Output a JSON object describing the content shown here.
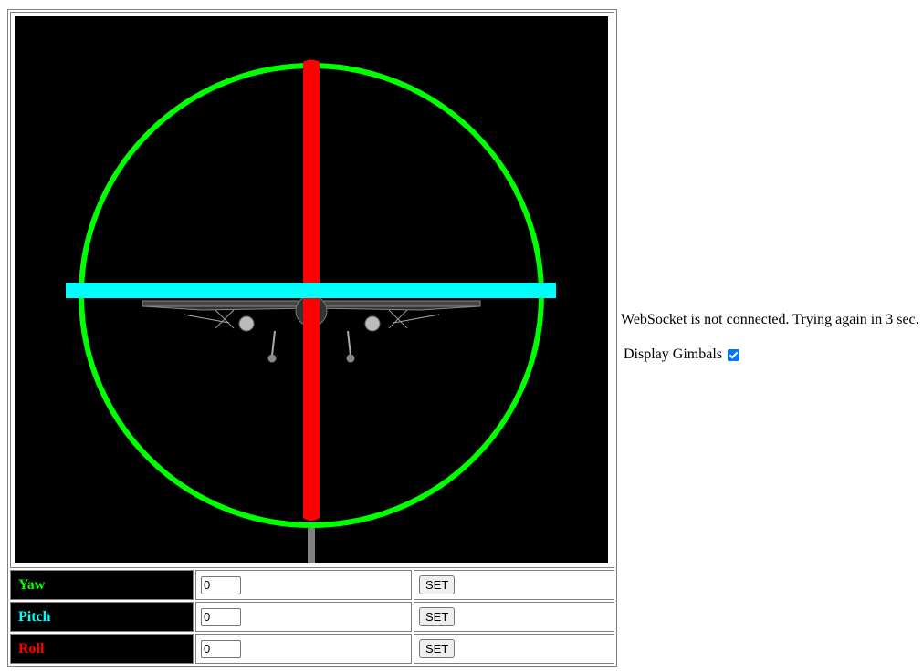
{
  "status_text": "WebSocket is not connected. Trying again in 3 sec.",
  "gimbals": {
    "label": "Display Gimbals",
    "checked": true
  },
  "controls": [
    {
      "label": "Yaw",
      "color": "#00ff00",
      "value": "0",
      "button": "SET"
    },
    {
      "label": "Pitch",
      "color": "#00ffff",
      "value": "0",
      "button": "SET"
    },
    {
      "label": "Roll",
      "color": "#ff0000",
      "value": "0",
      "button": "SET"
    }
  ],
  "colors": {
    "yaw_ring": "#00ff00",
    "pitch_ring": "#00ffff",
    "roll_ring": "#ff0000",
    "background": "#000000"
  }
}
